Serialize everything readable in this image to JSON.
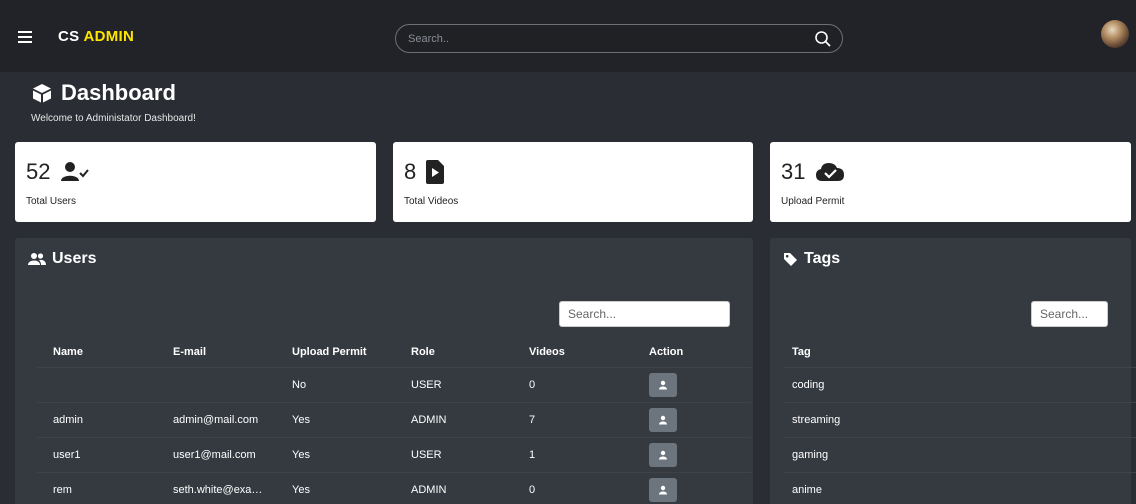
{
  "topbar": {
    "brand_prefix": "CS",
    "brand_accent": "ADMIN",
    "search_placeholder": "Search..",
    "accent_color": "#ffe600"
  },
  "header": {
    "title": "Dashboard",
    "subtitle": "Welcome to Administator Dashboard!"
  },
  "stats": [
    {
      "value": "52",
      "label": "Total Users",
      "icon": "user-check-icon"
    },
    {
      "value": "8",
      "label": "Total Videos",
      "icon": "file-video-icon"
    },
    {
      "value": "31",
      "label": "Upload Permit",
      "icon": "cloud-check-icon"
    }
  ],
  "users_panel": {
    "title": "Users",
    "search_placeholder": "Search...",
    "columns": [
      "Name",
      "E-mail",
      "Upload Permit",
      "Role",
      "Videos",
      "Action"
    ],
    "rows": [
      {
        "name": "",
        "email": "",
        "upload": "No",
        "role": "USER",
        "videos": "0"
      },
      {
        "name": "admin",
        "email": "admin@mail.com",
        "upload": "Yes",
        "role": "ADMIN",
        "videos": "7"
      },
      {
        "name": "user1",
        "email": "user1@mail.com",
        "upload": "Yes",
        "role": "USER",
        "videos": "1"
      },
      {
        "name": "rem",
        "email": "seth.white@exa…",
        "upload": "Yes",
        "role": "ADMIN",
        "videos": "0"
      }
    ]
  },
  "tags_panel": {
    "title": "Tags",
    "search_placeholder": "Search...",
    "column": "Tag",
    "rows": [
      "coding",
      "streaming",
      "gaming",
      "anime"
    ]
  }
}
